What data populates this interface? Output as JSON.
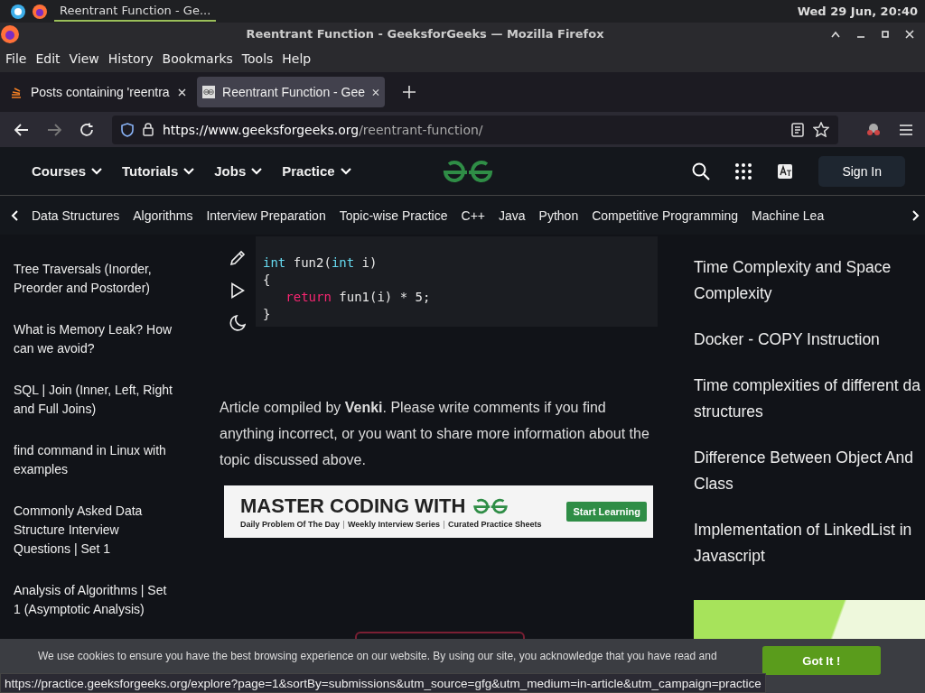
{
  "taskbar": {
    "window_button": "Reentrant Function - Ge...",
    "clock": "Wed 29 Jun, 20:40"
  },
  "window": {
    "title": "Reentrant Function - GeeksforGeeks — Mozilla Firefox"
  },
  "menu": [
    "File",
    "Edit",
    "View",
    "History",
    "Bookmarks",
    "Tools",
    "Help"
  ],
  "tabs": [
    {
      "label": "Posts containing 'reentra",
      "selected": false
    },
    {
      "label": "Reentrant Function - Gee",
      "selected": true
    }
  ],
  "url": {
    "host": "https://www.geeksforgeeks.org",
    "path": "/reentrant-function/"
  },
  "site_nav": {
    "items": [
      "Courses",
      "Tutorials",
      "Jobs",
      "Practice"
    ],
    "sign_in": "Sign In"
  },
  "categories": [
    "Data Structures",
    "Algorithms",
    "Interview Preparation",
    "Topic-wise Practice",
    "C++",
    "Java",
    "Python",
    "Competitive Programming",
    "Machine Lea"
  ],
  "sidebar": [
    "Tree Traversals (Inorder, Preorder and Postorder)",
    "What is Memory Leak? How can we avoid?",
    "SQL | Join (Inner, Left, Right and Full Joins)",
    "find command in Linux with examples",
    "Commonly Asked Data Structure Interview Questions | Set 1",
    "Analysis of Algorithms | Set 1 (Asymptotic Analysis)"
  ],
  "code": [
    [
      {
        "kind": "type",
        "text": "int"
      },
      {
        "kind": "plain",
        "text": " fun2("
      },
      {
        "kind": "type",
        "text": "int"
      },
      {
        "kind": "plain",
        "text": " i)"
      }
    ],
    [
      {
        "kind": "plain",
        "text": "{"
      }
    ],
    [
      {
        "kind": "keyword",
        "text": "   return"
      },
      {
        "kind": "plain",
        "text": " fun1(i) * 5;"
      }
    ],
    [
      {
        "kind": "plain",
        "text": "}"
      }
    ]
  ],
  "article_note": "Article compiled by **Venki**. Please write comments if you find anything incorrect, or you want to share more information about the topic discussed above.",
  "ad": {
    "headline": "MASTER CODING WITH",
    "features": [
      "Daily Problem Of The Day",
      "Weekly Interview Series",
      "Curated Practice Sheets"
    ],
    "button": "Start Learning"
  },
  "related": [
    "Time Complexity and Space Complexity",
    "Docker - COPY Instruction",
    "Time complexities of different da structures",
    "Difference Between Object And Class",
    "Implementation of LinkedList in Javascript"
  ],
  "cookie": {
    "text": "We use cookies to ensure you have the best browsing experience on our website. By using our site, you acknowledge that you have read and",
    "button": "Got It !"
  },
  "status_url": "https://practice.geeksforgeeks.org/explore?page=1&sortBy=submissions&utm_source=gfg&utm_medium=in-article&utm_campaign=practice"
}
